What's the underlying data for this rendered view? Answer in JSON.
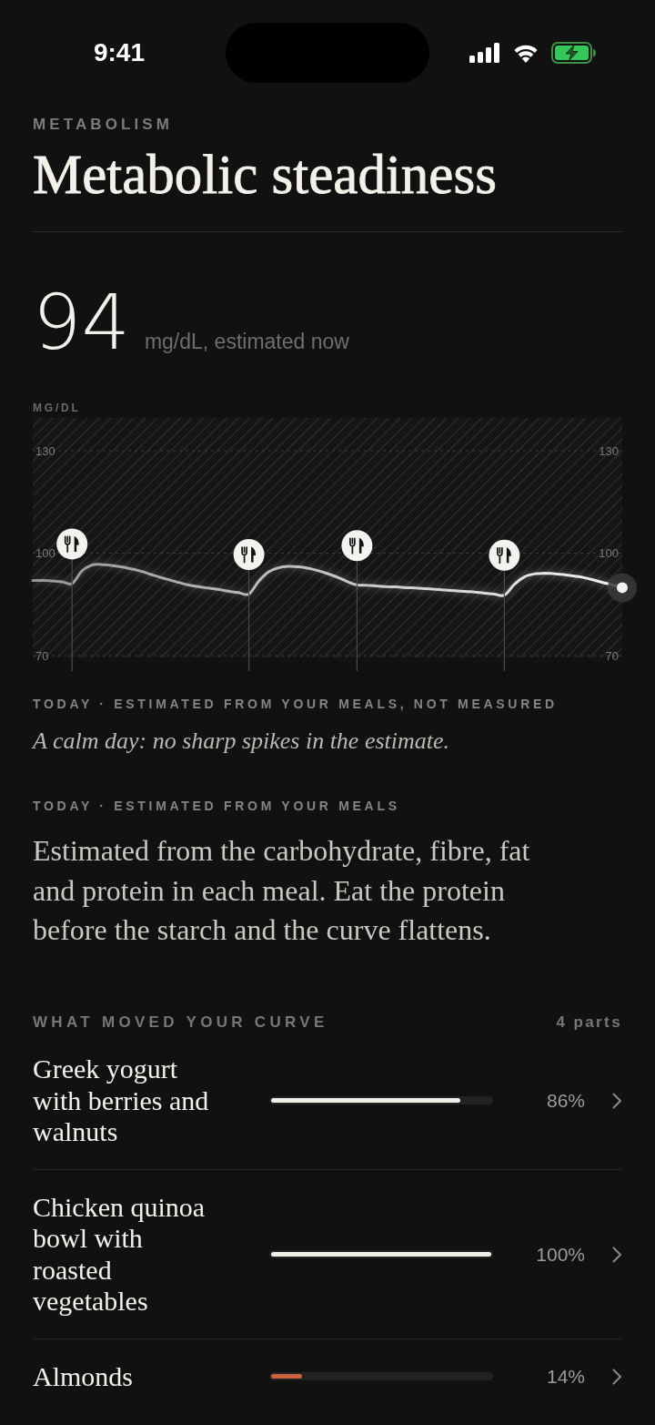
{
  "status_bar": {
    "time": "9:41"
  },
  "header": {
    "eyebrow": "METABOLISM",
    "title": "Metabolic steadiness"
  },
  "reading": {
    "value": "94",
    "note": "mg/dL, estimated now"
  },
  "chart": {
    "chart_data": {
      "type": "line",
      "ylabel": "MG/DL",
      "categories": [
        null,
        null,
        null,
        null,
        null,
        null,
        null,
        null,
        null,
        null,
        null,
        null,
        null,
        null,
        null,
        null,
        null,
        null,
        null,
        null,
        null,
        null,
        null,
        null,
        null,
        null,
        null,
        null,
        null,
        null,
        null,
        null,
        null,
        null,
        null,
        null,
        null,
        null,
        null,
        null,
        null,
        null,
        null,
        null,
        null,
        null,
        null,
        null,
        null,
        null,
        null,
        null,
        null,
        null,
        null,
        null,
        null,
        null,
        null,
        null,
        null
      ],
      "ylim": [
        70,
        130
      ],
      "yticks": [
        70,
        100,
        130
      ],
      "series": [
        {
          "color": "#f4f2ee",
          "values": [
            92.0,
            92.0,
            91.9,
            91.6,
            91.1,
            94.8,
            96.5,
            96.7,
            96.4,
            96.0,
            95.4,
            94.7,
            93.8,
            92.9,
            92.1,
            91.3,
            90.6,
            90.1,
            89.7,
            89.3,
            88.8,
            88.4,
            88.0,
            91.8,
            94.5,
            95.7,
            96.1,
            96.0,
            95.6,
            94.9,
            94.0,
            93.0,
            91.7,
            90.7,
            90.6,
            90.4,
            90.2,
            90.1,
            89.9,
            89.8,
            89.6,
            89.4,
            89.2,
            89.0,
            88.8,
            88.6,
            88.3,
            88.0,
            87.7,
            90.8,
            93.0,
            93.9,
            94.1,
            94.0,
            93.7,
            93.3,
            92.9,
            92.2,
            91.4,
            90.7,
            89.9
          ]
        },
        {
          "color": "#f4f2ee",
          "marker": "circle",
          "values": [
            null,
            null,
            null,
            null,
            102.7,
            null,
            null,
            null,
            null,
            null,
            null,
            null,
            null,
            null,
            null,
            null,
            null,
            null,
            null,
            null,
            null,
            null,
            99.6,
            null,
            null,
            null,
            null,
            null,
            null,
            null,
            null,
            null,
            null,
            102.2,
            null,
            null,
            null,
            null,
            null,
            null,
            null,
            null,
            null,
            null,
            null,
            null,
            null,
            null,
            99.4,
            null,
            null,
            null,
            null,
            null,
            null,
            null,
            null,
            null,
            null,
            null,
            null
          ]
        }
      ]
    },
    "right_axis_labels": [
      "130",
      "100",
      "70"
    ]
  },
  "chart_caption": "TODAY · ESTIMATED FROM YOUR MEALS, NOT MEASURED",
  "chart_summary": "A calm day: no sharp spikes in the estimate.",
  "explanation": {
    "caption": "TODAY · ESTIMATED FROM YOUR MEALS",
    "text": "Estimated from the carbohydrate, fibre, fat and protein in each meal. Eat the protein before the starch and the curve flattens."
  },
  "contributors": {
    "title": "WHAT MOVED YOUR CURVE",
    "count": "4 parts",
    "items": [
      {
        "name": "Greek yogurt with berries and walnuts",
        "level": 0.86,
        "reading": "86%",
        "color": "#f2efe9"
      },
      {
        "name": "Chicken quinoa bowl with roasted vegetables",
        "level": 1.0,
        "reading": "100%",
        "color": "#f2efe9"
      },
      {
        "name": "Almonds",
        "level": 0.14,
        "reading": "14%",
        "color": "#c9623f"
      }
    ]
  }
}
